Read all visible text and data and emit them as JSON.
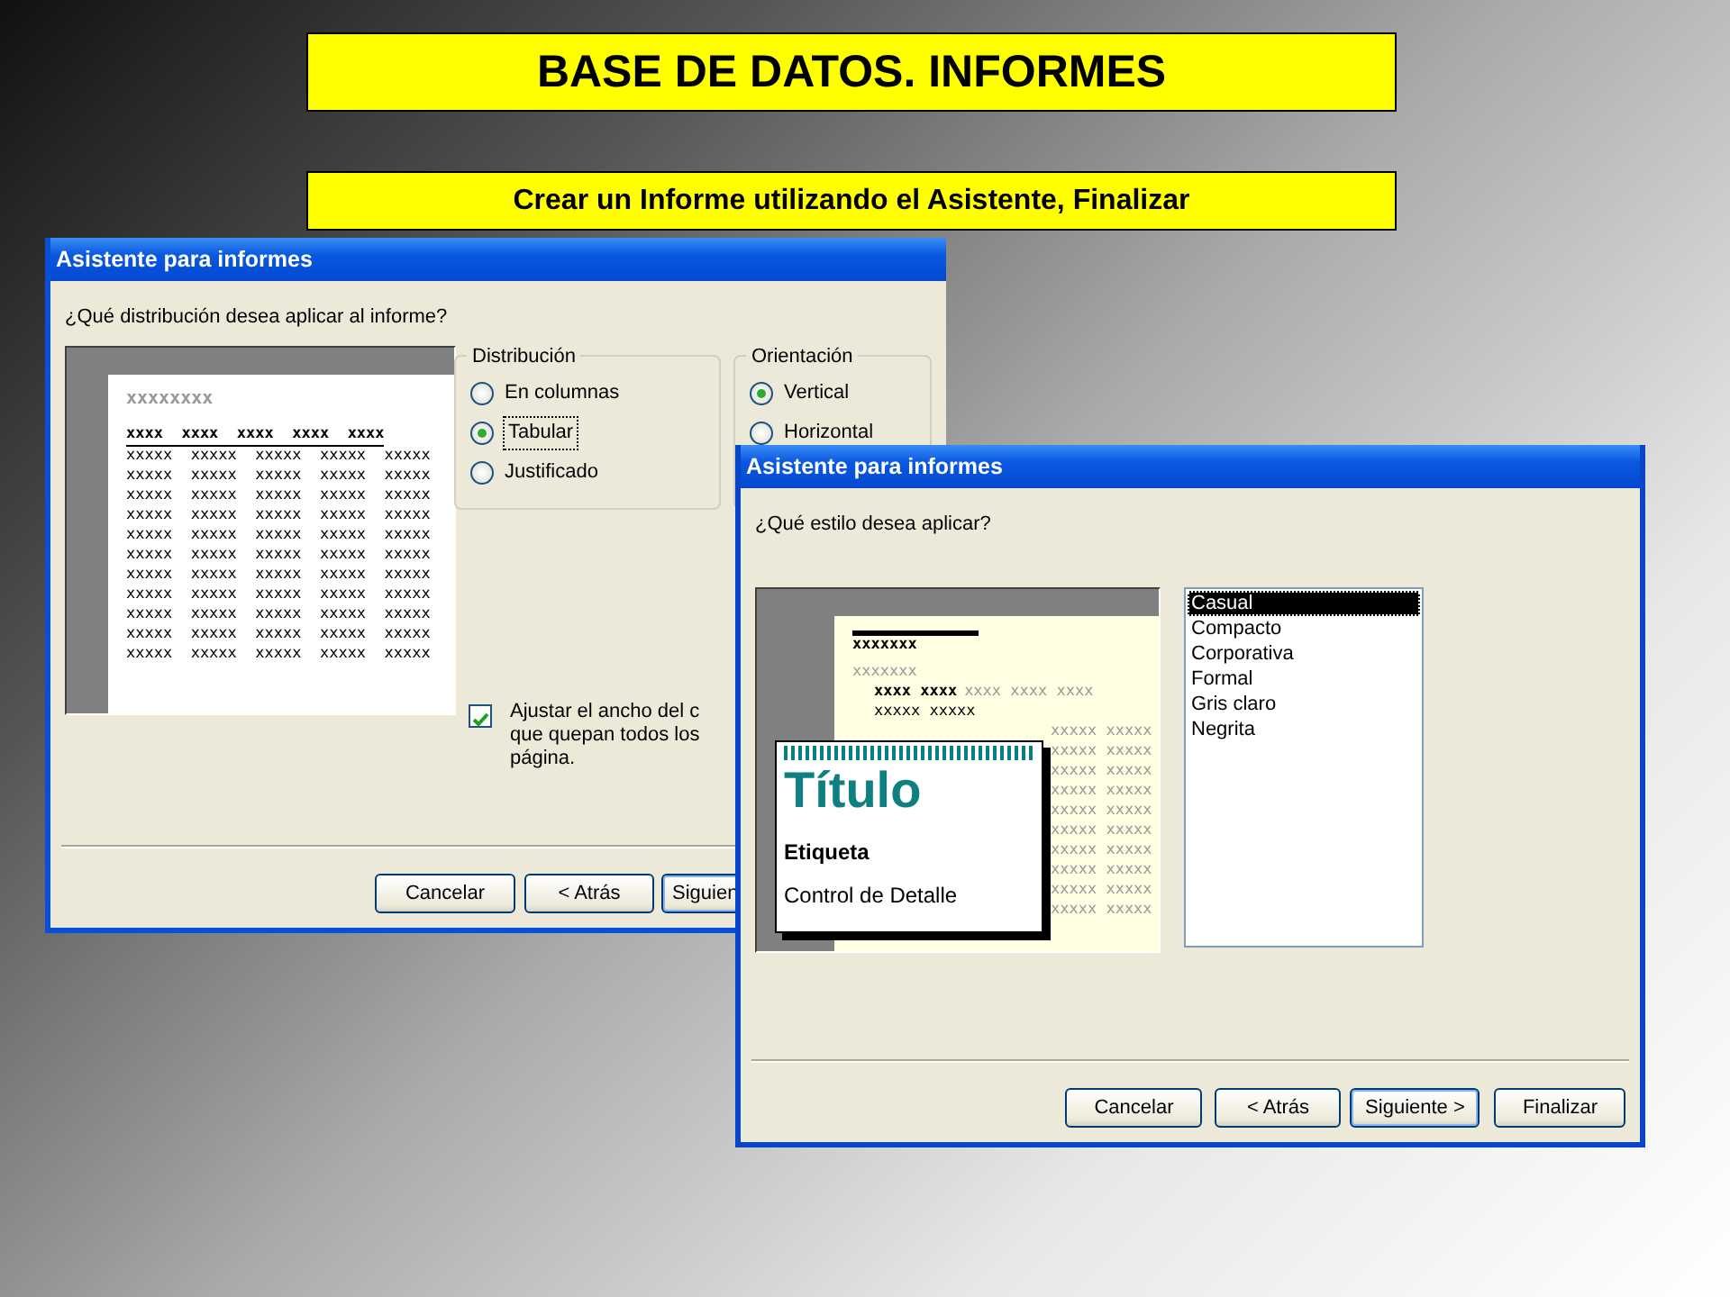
{
  "slide": {
    "title": "BASE DE DATOS. INFORMES",
    "subtitle": "Crear un Informe utilizando el Asistente, Finalizar"
  },
  "windows": [
    {
      "title": "Asistente para informes",
      "question": "¿Qué distribución desea aplicar al informe?",
      "preview": {
        "heading": "xxxxxxxx",
        "header": "xxxx  xxxx  xxxx  xxxx  xxxx",
        "rows": [
          "xxxxx  xxxxx  xxxxx  xxxxx  xxxxx",
          "xxxxx  xxxxx  xxxxx  xxxxx  xxxxx",
          "xxxxx  xxxxx  xxxxx  xxxxx  xxxxx",
          "xxxxx  xxxxx  xxxxx  xxxxx  xxxxx",
          "xxxxx  xxxxx  xxxxx  xxxxx  xxxxx",
          "xxxxx  xxxxx  xxxxx  xxxxx  xxxxx",
          "xxxxx  xxxxx  xxxxx  xxxxx  xxxxx",
          "xxxxx  xxxxx  xxxxx  xxxxx  xxxxx",
          "xxxxx  xxxxx  xxxxx  xxxxx  xxxxx",
          "xxxxx  xxxxx  xxxxx  xxxxx  xxxxx",
          "xxxxx  xxxxx  xxxxx  xxxxx  xxxxx"
        ]
      },
      "groups": [
        {
          "label": "Distribución",
          "options": [
            {
              "label": "En columnas",
              "selected": false
            },
            {
              "label": "Tabular",
              "selected": true
            },
            {
              "label": "Justificado",
              "selected": false
            }
          ]
        },
        {
          "label": "Orientación",
          "options": [
            {
              "label": "Vertical",
              "selected": true
            },
            {
              "label": "Horizontal",
              "selected": false
            }
          ]
        }
      ],
      "checkbox": {
        "lines": [
          "Ajustar el ancho del c",
          "que quepan todos los",
          "página."
        ],
        "checked": true
      },
      "buttons": [
        {
          "label": "Cancelar"
        },
        {
          "label": "< Atrás"
        },
        {
          "label": "Siguien"
        }
      ]
    },
    {
      "title": "Asistente para informes",
      "question": "¿Qué estilo desea aplicar?",
      "style_preview": {
        "heading": "xxxxxxx",
        "subheading": "xxxxxxx",
        "header": "xxxx xxxx",
        "header_faded": "xxxx xxxx xxxx",
        "first_row": "xxxxx xxxxx",
        "rows": [
          "xxxxx xxxxx",
          "xxxxx xxxxx",
          "xxxxx xxxxx",
          "xxxxx xxxxx",
          "xxxxx xxxxx",
          "xxxxx xxxxx",
          "xxxxx xxxxx",
          "xxxxx xxxxx",
          "xxxxx xxxxx",
          "xxxxx xxxxx"
        ],
        "title": "Título",
        "label": "Etiqueta",
        "detail": "Control de Detalle"
      },
      "styles": [
        {
          "label": "Casual",
          "selected": true
        },
        {
          "label": "Compacto",
          "selected": false
        },
        {
          "label": "Corporativa",
          "selected": false
        },
        {
          "label": "Formal",
          "selected": false
        },
        {
          "label": "Gris claro",
          "selected": false
        },
        {
          "label": "Negrita",
          "selected": false
        }
      ],
      "buttons": [
        {
          "label": "Cancelar"
        },
        {
          "label": "< Atrás"
        },
        {
          "label": "Siguiente >"
        },
        {
          "label": "Finalizar"
        }
      ]
    }
  ]
}
